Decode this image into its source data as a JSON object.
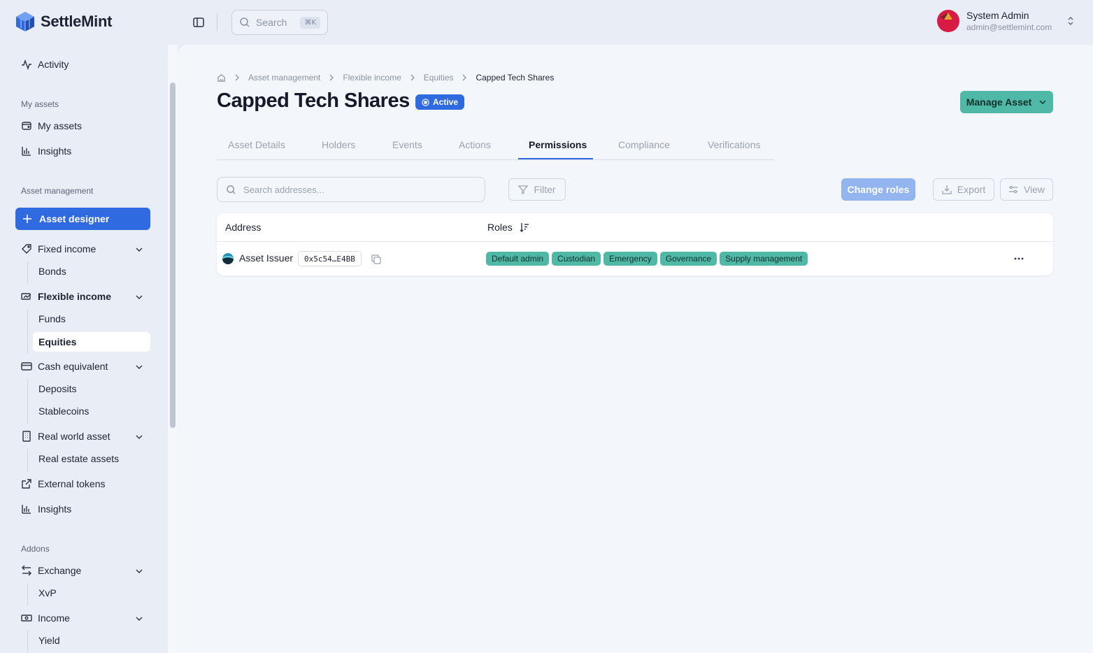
{
  "app": {
    "name": "SettleMint",
    "search_placeholder": "Search",
    "search_shortcut": "⌘K",
    "brand_color": "#2f6ae0",
    "accent_teal": "#4fb8a6"
  },
  "user": {
    "name": "System Admin",
    "email": "admin@settlemint.com"
  },
  "sidebar": {
    "activity": "Activity",
    "my_assets_section": "My assets",
    "my_assets": "My assets",
    "insights_top": "Insights",
    "asset_management_section": "Asset management",
    "asset_designer": "Asset designer",
    "fixed_income": "Fixed income",
    "bonds": "Bonds",
    "flexible_income": "Flexible income",
    "funds": "Funds",
    "equities": "Equities",
    "cash_equivalent": "Cash equivalent",
    "deposits": "Deposits",
    "stablecoins": "Stablecoins",
    "real_world_asset": "Real world asset",
    "real_estate_assets": "Real estate assets",
    "external_tokens": "External tokens",
    "insights": "Insights",
    "addons_section": "Addons",
    "exchange": "Exchange",
    "xvp": "XvP",
    "income": "Income",
    "yield": "Yield"
  },
  "breadcrumb": [
    "Asset management",
    "Flexible income",
    "Equities",
    "Capped Tech Shares"
  ],
  "page": {
    "title": "Capped Tech Shares",
    "status": "Active",
    "manage_button": "Manage Asset"
  },
  "tabs": [
    "Asset Details",
    "Holders",
    "Events",
    "Actions",
    "Permissions",
    "Compliance",
    "Verifications"
  ],
  "active_tab": "Permissions",
  "toolbar": {
    "search_placeholder": "Search addresses...",
    "filter": "Filter",
    "change_roles": "Change roles",
    "export": "Export",
    "view": "View"
  },
  "table": {
    "headers": {
      "address": "Address",
      "roles": "Roles"
    },
    "rows": [
      {
        "name": "Asset Issuer",
        "address": "0x5c54…E4BB",
        "roles": [
          "Default admin",
          "Custodian",
          "Emergency",
          "Governance",
          "Supply management"
        ]
      }
    ]
  }
}
